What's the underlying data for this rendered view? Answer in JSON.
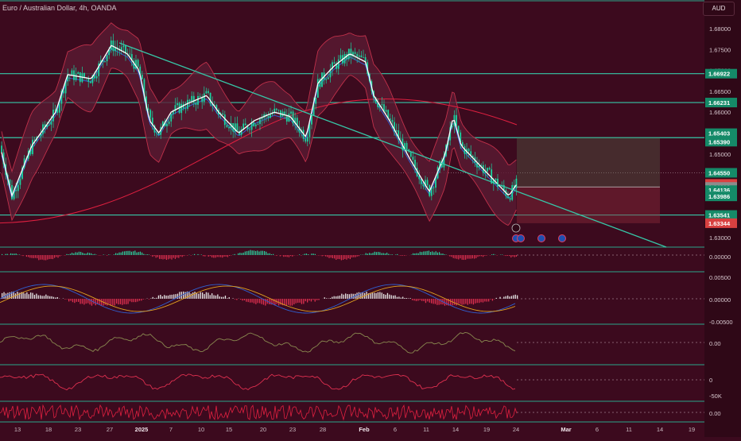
{
  "header": {
    "title": "Euro / Australian Dollar, 4h, OANDA",
    "currency": "AUD"
  },
  "price_axis": {
    "ticks": [
      "1.68000",
      "1.67500",
      "1.67000",
      "1.66500",
      "1.66000",
      "1.65500",
      "1.65000",
      "1.64500",
      "1.64000",
      "1.63500",
      "1.63000"
    ],
    "tags": [
      {
        "label": "1.66922",
        "price": 1.66922,
        "color": "#158a68"
      },
      {
        "label": "1.66231",
        "price": 1.66231,
        "color": "#158a68"
      },
      {
        "label": "1.65403",
        "price": 1.65403,
        "color": "#158a68"
      },
      {
        "label": "1.65390",
        "price": 1.6539,
        "color": "#158a68"
      },
      {
        "label": "1.64550",
        "price": 1.6455,
        "color": "#158a68"
      },
      {
        "label": "1.64286",
        "price": 1.64286,
        "color": "#d84040"
      },
      {
        "label": "1.64212",
        "price": 1.64212,
        "color": "#8c8c8c"
      },
      {
        "label": "1.64136",
        "price": 1.64136,
        "color": "#158a68"
      },
      {
        "label": "1.63986",
        "price": 1.63986,
        "color": "#158a68"
      },
      {
        "label": "1.63541",
        "price": 1.63541,
        "color": "#158a68"
      },
      {
        "label": "1.63344",
        "price": 1.63344,
        "color": "#d84040"
      }
    ]
  },
  "indicator_axes": {
    "pane1": [
      "0.00000"
    ],
    "pane2": [
      "0.00500",
      "0.00000",
      "-0.00500"
    ],
    "pane3": [
      "0.00"
    ],
    "pane4": [
      "0",
      "-50K"
    ],
    "pane5": [
      "0.00"
    ]
  },
  "time_axis": {
    "labels": [
      "13",
      "18",
      "23",
      "27",
      "2025",
      "7",
      "10",
      "15",
      "20",
      "23",
      "28",
      "Feb",
      "6",
      "11",
      "14",
      "19",
      "24",
      "Mar",
      "6",
      "11",
      "14",
      "19"
    ]
  },
  "levels": [
    1.66922,
    1.66231,
    1.6539,
    1.63541
  ],
  "colors": {
    "bg": "#3c0a1e",
    "axis_bg": "#2f0817",
    "level": "#36c8a8",
    "candle": "#19d4a0",
    "bollinger": "#c0304a",
    "ma": "#ffffff",
    "blue": "#2f5fd0",
    "red_line": "#e02040"
  }
}
